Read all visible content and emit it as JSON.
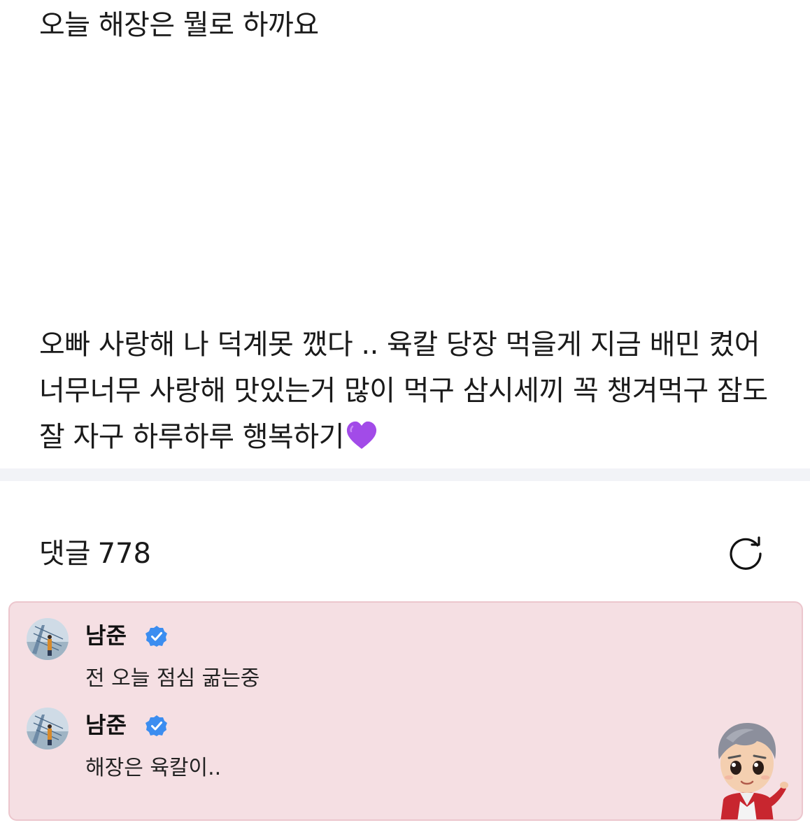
{
  "post": {
    "title": "오늘 해장은 뭘로 하까요",
    "body": "오빠 사랑해 나 덕계못 깼다 .. 육칼 당장 먹을게 지금 배민 켰어 너무너무 사랑해 맛있는거 많이 먹구 삼시세끼 꼭 챙겨먹구 잠도 잘 자구 하루하루 행복하기",
    "body_emoji": "purple-heart-icon"
  },
  "comments": {
    "label": "댓글",
    "count": "778",
    "refresh_icon": "refresh-icon"
  },
  "artist_comments": [
    {
      "author": "남준",
      "verified": true,
      "text": "전 오늘 점심 굶는중"
    },
    {
      "author": "남준",
      "verified": true,
      "text": "해장은 육칼이.."
    }
  ],
  "colors": {
    "artist_box_bg": "#f5dfe3",
    "verified_blue": "#3b8df0",
    "heart_purple": "#a24be8"
  }
}
